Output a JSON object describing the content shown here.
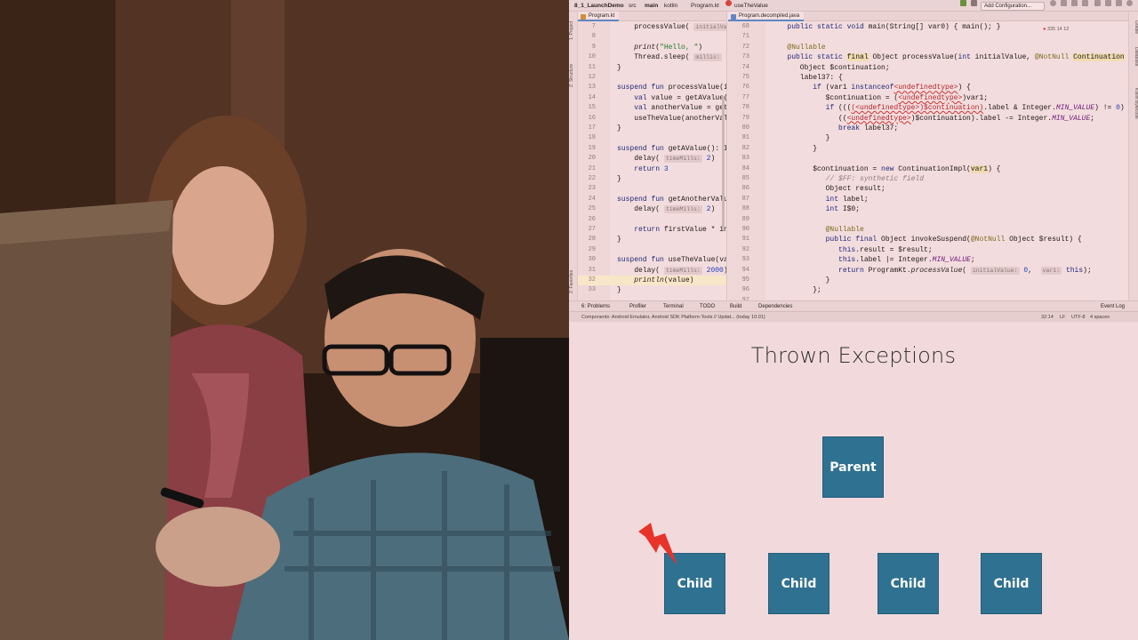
{
  "ide": {
    "nav": {
      "project": "8_1_LaunchDemo",
      "crumbs": [
        "src",
        "main",
        "kotlin",
        "Program.kt",
        "useTheValue"
      ],
      "run_config": "Add Configuration...",
      "problems_badge": "335  14  12"
    },
    "left_tool_tabs": [
      "1: Project",
      "Z: Structure",
      "2: Favorites"
    ],
    "right_tool_tabs": [
      "Gradle",
      "Database",
      "Kotlin Bytecode"
    ],
    "editor1": {
      "tab": "Program.kt",
      "lines": [
        {
          "n": "7",
          "parts": [
            [
              "t",
              "    processValue( "
            ],
            [
              "h",
              "initialValue:"
            ]
          ]
        },
        {
          "n": "8",
          "parts": [
            [
              "t",
              ""
            ]
          ]
        },
        {
          "n": "9",
          "parts": [
            [
              "t",
              "    "
            ],
            [
              "i",
              "print"
            ],
            [
              "t",
              "("
            ],
            [
              "s",
              "\"Hello, \""
            ],
            [
              "t",
              ")"
            ]
          ]
        },
        {
          "n": "10",
          "parts": [
            [
              "t",
              "    Thread.sleep( "
            ],
            [
              "h",
              "millis:"
            ],
            [
              "t",
              " "
            ],
            [
              "n",
              "1500"
            ],
            [
              "t",
              ")"
            ]
          ]
        },
        {
          "n": "11",
          "parts": [
            [
              "t",
              "}"
            ]
          ]
        },
        {
          "n": "12",
          "parts": [
            [
              "t",
              ""
            ]
          ]
        },
        {
          "n": "13",
          "parts": [
            [
              "k",
              "suspend fun "
            ],
            [
              "t",
              "processValue(init"
            ]
          ]
        },
        {
          "n": "14",
          "parts": [
            [
              "k",
              "    val "
            ],
            [
              "t",
              "value = getAValue()"
            ]
          ]
        },
        {
          "n": "15",
          "parts": [
            [
              "k",
              "    val "
            ],
            [
              "t",
              "anotherValue = getAn"
            ]
          ]
        },
        {
          "n": "16",
          "parts": [
            [
              "t",
              "    useTheValue(anotherValue"
            ]
          ]
        },
        {
          "n": "17",
          "parts": [
            [
              "t",
              "}"
            ]
          ]
        },
        {
          "n": "18",
          "parts": [
            [
              "t",
              ""
            ]
          ]
        },
        {
          "n": "19",
          "parts": [
            [
              "k",
              "suspend fun "
            ],
            [
              "t",
              "getAValue(): Int"
            ]
          ]
        },
        {
          "n": "20",
          "parts": [
            [
              "t",
              "    delay( "
            ],
            [
              "h",
              "timeMills:"
            ],
            [
              "t",
              " "
            ],
            [
              "n",
              "2"
            ],
            [
              "t",
              ")"
            ]
          ]
        },
        {
          "n": "21",
          "parts": [
            [
              "k",
              "    return "
            ],
            [
              "n",
              "3"
            ]
          ]
        },
        {
          "n": "22",
          "parts": [
            [
              "t",
              "}"
            ]
          ]
        },
        {
          "n": "23",
          "parts": [
            [
              "t",
              ""
            ]
          ]
        },
        {
          "n": "24",
          "parts": [
            [
              "k",
              "suspend fun "
            ],
            [
              "t",
              "getAnotherValue("
            ]
          ]
        },
        {
          "n": "25",
          "parts": [
            [
              "t",
              "    delay( "
            ],
            [
              "h",
              "timeMills:"
            ],
            [
              "t",
              " "
            ],
            [
              "n",
              "2"
            ],
            [
              "t",
              ")"
            ]
          ]
        },
        {
          "n": "26",
          "parts": [
            [
              "t",
              ""
            ]
          ]
        },
        {
          "n": "27",
          "parts": [
            [
              "k",
              "    return "
            ],
            [
              "t",
              "firstValue * init"
            ]
          ]
        },
        {
          "n": "28",
          "parts": [
            [
              "t",
              "}"
            ]
          ]
        },
        {
          "n": "29",
          "parts": [
            [
              "t",
              ""
            ]
          ]
        },
        {
          "n": "30",
          "parts": [
            [
              "k",
              "suspend fun "
            ],
            [
              "t",
              "useTheValue(value"
            ]
          ]
        },
        {
          "n": "31",
          "parts": [
            [
              "t",
              "    delay( "
            ],
            [
              "h",
              "timeMills:"
            ],
            [
              "t",
              " "
            ],
            [
              "n",
              "2000"
            ],
            [
              "t",
              ")"
            ]
          ]
        },
        {
          "n": "32",
          "parts": [
            [
              "t",
              "    "
            ],
            [
              "i",
              "println"
            ],
            [
              "t",
              "(value)"
            ]
          ]
        },
        {
          "n": "33",
          "parts": [
            [
              "t",
              "}"
            ]
          ]
        }
      ]
    },
    "editor2": {
      "tab": "Program.decompiled.java",
      "lines": [
        {
          "n": "68",
          "parts": [
            [
              "k",
              "   public static void "
            ],
            [
              "t",
              "main(String[] var0) { main(); }"
            ]
          ]
        },
        {
          "n": "71",
          "parts": [
            [
              "t",
              ""
            ]
          ]
        },
        {
          "n": "72",
          "parts": [
            [
              "a",
              "   @Nullable"
            ]
          ]
        },
        {
          "n": "73",
          "parts": [
            [
              "k",
              "   public static "
            ],
            [
              "w",
              "final"
            ],
            [
              "t",
              " Object processValue("
            ],
            [
              "k",
              "int "
            ],
            [
              "t",
              "initialValue, "
            ],
            [
              "a",
              "@NotNull "
            ],
            [
              "w",
              "Continuation"
            ],
            [
              "t",
              " var1) {"
            ]
          ]
        },
        {
          "n": "74",
          "parts": [
            [
              "t",
              "      Object $continuation;"
            ]
          ]
        },
        {
          "n": "75",
          "parts": [
            [
              "t",
              "      label37: {"
            ]
          ]
        },
        {
          "n": "76",
          "parts": [
            [
              "k",
              "         if "
            ],
            [
              "t",
              "(var1 "
            ],
            [
              "k",
              "instanceof"
            ],
            [
              "e",
              "<undefinedtype>"
            ],
            [
              "t",
              ") {"
            ]
          ]
        },
        {
          "n": "77",
          "parts": [
            [
              "t",
              "            $continuation = ("
            ],
            [
              "e",
              "<undefinedtype>"
            ],
            [
              "t",
              ")var1;"
            ]
          ]
        },
        {
          "n": "78",
          "parts": [
            [
              "k",
              "            if "
            ],
            [
              "t",
              "((("
            ],
            [
              "e",
              "(<undefinedtype>)$continuation)"
            ],
            [
              "t",
              ".label & Integer."
            ],
            [
              "f",
              "MIN_VALUE"
            ],
            [
              "t",
              ") != "
            ],
            [
              "n",
              "0"
            ],
            [
              "t",
              ") {"
            ]
          ]
        },
        {
          "n": "79",
          "parts": [
            [
              "t",
              "               (("
            ],
            [
              "e",
              "<undefinedtype>"
            ],
            [
              "t",
              ")$continuation).label -= Integer."
            ],
            [
              "f",
              "MIN_VALUE"
            ],
            [
              "t",
              ";"
            ]
          ]
        },
        {
          "n": "80",
          "parts": [
            [
              "k",
              "               break "
            ],
            [
              "t",
              "label37;"
            ]
          ]
        },
        {
          "n": "81",
          "parts": [
            [
              "t",
              "            }"
            ]
          ]
        },
        {
          "n": "82",
          "parts": [
            [
              "t",
              "         }"
            ]
          ]
        },
        {
          "n": "83",
          "parts": [
            [
              "t",
              ""
            ]
          ]
        },
        {
          "n": "84",
          "parts": [
            [
              "t",
              "         $continuation = "
            ],
            [
              "k",
              "new "
            ],
            [
              "t",
              "ContinuationImpl("
            ],
            [
              "w",
              "var1"
            ],
            [
              "t",
              ") {"
            ]
          ]
        },
        {
          "n": "85",
          "parts": [
            [
              "c",
              "            // $FF: synthetic field"
            ]
          ]
        },
        {
          "n": "86",
          "parts": [
            [
              "t",
              "            Object result;"
            ]
          ]
        },
        {
          "n": "87",
          "parts": [
            [
              "k",
              "            int "
            ],
            [
              "t",
              "label;"
            ]
          ]
        },
        {
          "n": "88",
          "parts": [
            [
              "k",
              "            int "
            ],
            [
              "t",
              "I$0;"
            ]
          ]
        },
        {
          "n": "89",
          "parts": [
            [
              "t",
              ""
            ]
          ]
        },
        {
          "n": "90",
          "parts": [
            [
              "a",
              "            @Nullable"
            ]
          ]
        },
        {
          "n": "91",
          "parts": [
            [
              "k",
              "            public final "
            ],
            [
              "t",
              "Object invokeSuspend("
            ],
            [
              "a",
              "@NotNull "
            ],
            [
              "t",
              "Object $result) {"
            ]
          ]
        },
        {
          "n": "92",
          "parts": [
            [
              "k",
              "               this"
            ],
            [
              "t",
              ".result = $result;"
            ]
          ]
        },
        {
          "n": "93",
          "parts": [
            [
              "k",
              "               this"
            ],
            [
              "t",
              ".label |= Integer."
            ],
            [
              "f",
              "MIN_VALUE"
            ],
            [
              "t",
              ";"
            ]
          ]
        },
        {
          "n": "94",
          "parts": [
            [
              "k",
              "               return "
            ],
            [
              "t",
              "ProgramKt."
            ],
            [
              "i",
              "processValue"
            ],
            [
              "t",
              "( "
            ],
            [
              "h",
              "initialValue:"
            ],
            [
              "t",
              " "
            ],
            [
              "n",
              "0"
            ],
            [
              "t",
              ",  "
            ],
            [
              "h",
              "var1:"
            ],
            [
              "t",
              " "
            ],
            [
              "k",
              "this"
            ],
            [
              "t",
              ");"
            ]
          ]
        },
        {
          "n": "95",
          "parts": [
            [
              "t",
              "            }"
            ]
          ]
        },
        {
          "n": "96",
          "parts": [
            [
              "t",
              "         };"
            ]
          ]
        },
        {
          "n": "97",
          "parts": [
            [
              "t",
              ""
            ]
          ]
        }
      ]
    },
    "bottom_tabs": [
      "6: Problems",
      "Profiler",
      "Terminal",
      "TODO",
      "Build",
      "Dependencies",
      "Event Log"
    ],
    "status": {
      "message": "Components: Android Emulator, Android SDK Platform-Tools // Updat... (today 10:01)",
      "position": "32:14",
      "line_sep": "LF",
      "encoding": "UTF-8",
      "indent": "4 spaces"
    }
  },
  "slide": {
    "title": "Thrown Exceptions",
    "parent_label": "Parent",
    "children": [
      "Child",
      "Child",
      "Child",
      "Child"
    ]
  },
  "colors": {
    "slide_bg": "#f2dadc",
    "box_fill": "#2f7191",
    "bolt": "#e8332a"
  }
}
